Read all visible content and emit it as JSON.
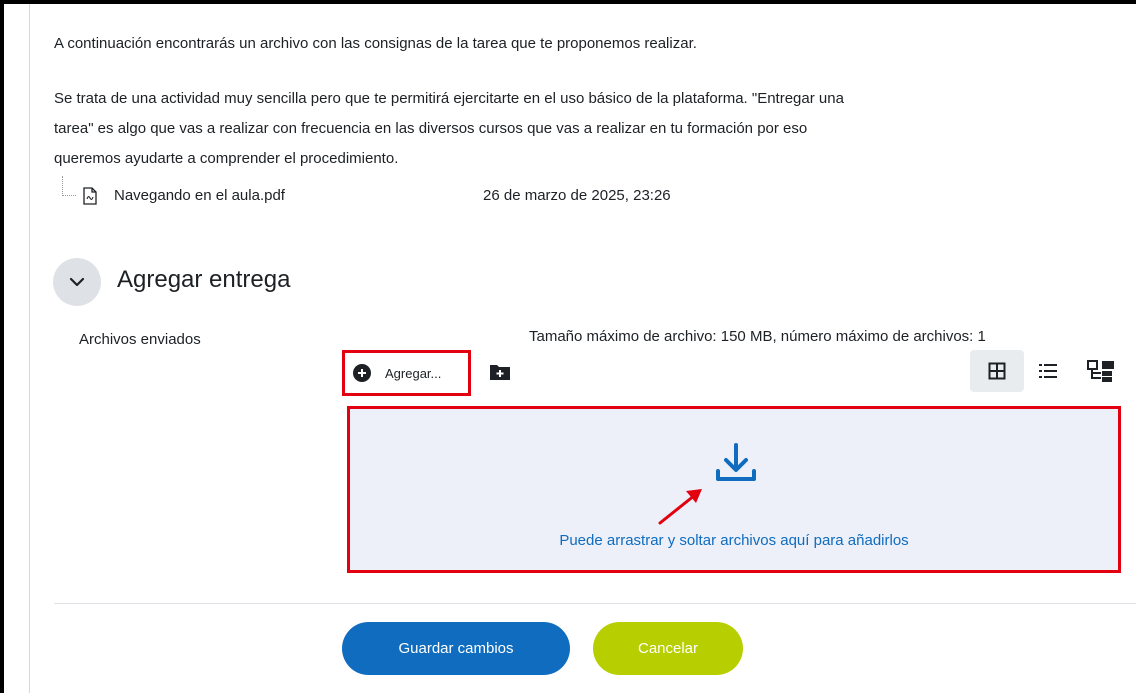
{
  "intro": {
    "line1": "A continuación encontrarás un archivo con las consignas de la tarea que te proponemos realizar.",
    "line2": "Se trata de una actividad muy sencilla pero que te permitirá ejercitarte en el uso básico de la plataforma. \"Entregar una",
    "line3": "tarea\" es algo que vas a realizar con frecuencia en las diversos cursos que vas a realizar en tu formación por eso",
    "line4": "queremos ayudarte a comprender el procedimiento."
  },
  "attachment": {
    "icon": "pdf-file-icon",
    "name": "Navegando en el aula.pdf",
    "date": "26 de marzo de 2025, 23:26"
  },
  "section": {
    "title": "Agregar entrega",
    "toggle_icon": "chevron-down-icon"
  },
  "filepicker": {
    "label": "Archivos enviados",
    "limits": "Tamaño máximo de archivo: 150 MB, número máximo de archivos: 1",
    "add_label": "Agregar...",
    "add_icon": "plus-circle-icon",
    "folder_icon": "folder-plus-icon",
    "views": [
      "grid-view-icon",
      "list-view-icon",
      "tree-view-icon"
    ],
    "dropzone_text": "Puede arrastrar y soltar archivos aquí para añadirlos",
    "dropzone_icon": "download-icon"
  },
  "actions": {
    "save": "Guardar cambios",
    "cancel": "Cancelar"
  },
  "colors": {
    "primary": "#0f6cbf",
    "cancel": "#b7cf00",
    "highlight": "#e3000f",
    "dropzone_bg": "#edf0f9"
  }
}
